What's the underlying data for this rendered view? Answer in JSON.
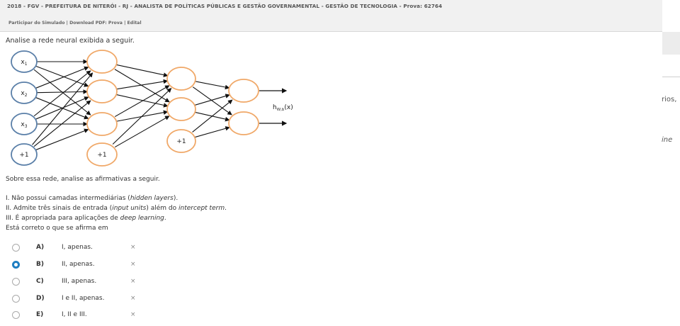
{
  "header": {
    "title": "2018 - FGV - PREFEITURA DE NITERÓI - RJ - ANALISTA DE POLÍTICAS PÚBLICAS E GESTÃO GOVERNAMENTAL - GESTÃO DE TECNOLOGIA - Prova: 62764",
    "link_participate": "Participar do Simulado",
    "sep1": " | ",
    "link_download": "Download PDF: Prova",
    "sep2": " | ",
    "link_edital": "Edital"
  },
  "right_fragments": {
    "frag1": "rios,",
    "frag2": "ine"
  },
  "question": {
    "intro": "Analise a rede neural exibida a seguir.",
    "diagram": {
      "inputs": [
        "x1",
        "x2",
        "x3",
        "+1"
      ],
      "bias_layer2": "+1",
      "bias_layer3": "+1",
      "output_label": "h",
      "output_sub": "W,b",
      "output_arg": "(x)"
    },
    "prompt": "Sobre essa rede, analise as afirmativas a seguir.",
    "statements": {
      "s1_a": "I. Não possui camadas intermediárias (",
      "s1_em": "hidden layers",
      "s1_b": ").",
      "s2_a": "II. Admite três sinais de entrada (",
      "s2_em": "input units",
      "s2_b": ") além do ",
      "s2_em2": "intercept term",
      "s2_c": ".",
      "s3_a": "III. É apropriada para aplicações de ",
      "s3_em": "deep learning",
      "s3_b": "."
    },
    "ask": "Está correto o que se afirma em"
  },
  "options": [
    {
      "letter": "A)",
      "text": "I, apenas.",
      "selected": false,
      "x": "×"
    },
    {
      "letter": "B)",
      "text": "II, apenas.",
      "selected": true,
      "x": "×"
    },
    {
      "letter": "C)",
      "text": "III, apenas.",
      "selected": false,
      "x": "×"
    },
    {
      "letter": "D)",
      "text": "I e II, apenas.",
      "selected": false,
      "x": "×"
    },
    {
      "letter": "E)",
      "text": "I, II e III.",
      "selected": false,
      "x": "×"
    }
  ],
  "colors": {
    "input_node": "#5a7fa8",
    "hidden_node": "#f0a868",
    "selected_radio": "#1f7fc2"
  }
}
